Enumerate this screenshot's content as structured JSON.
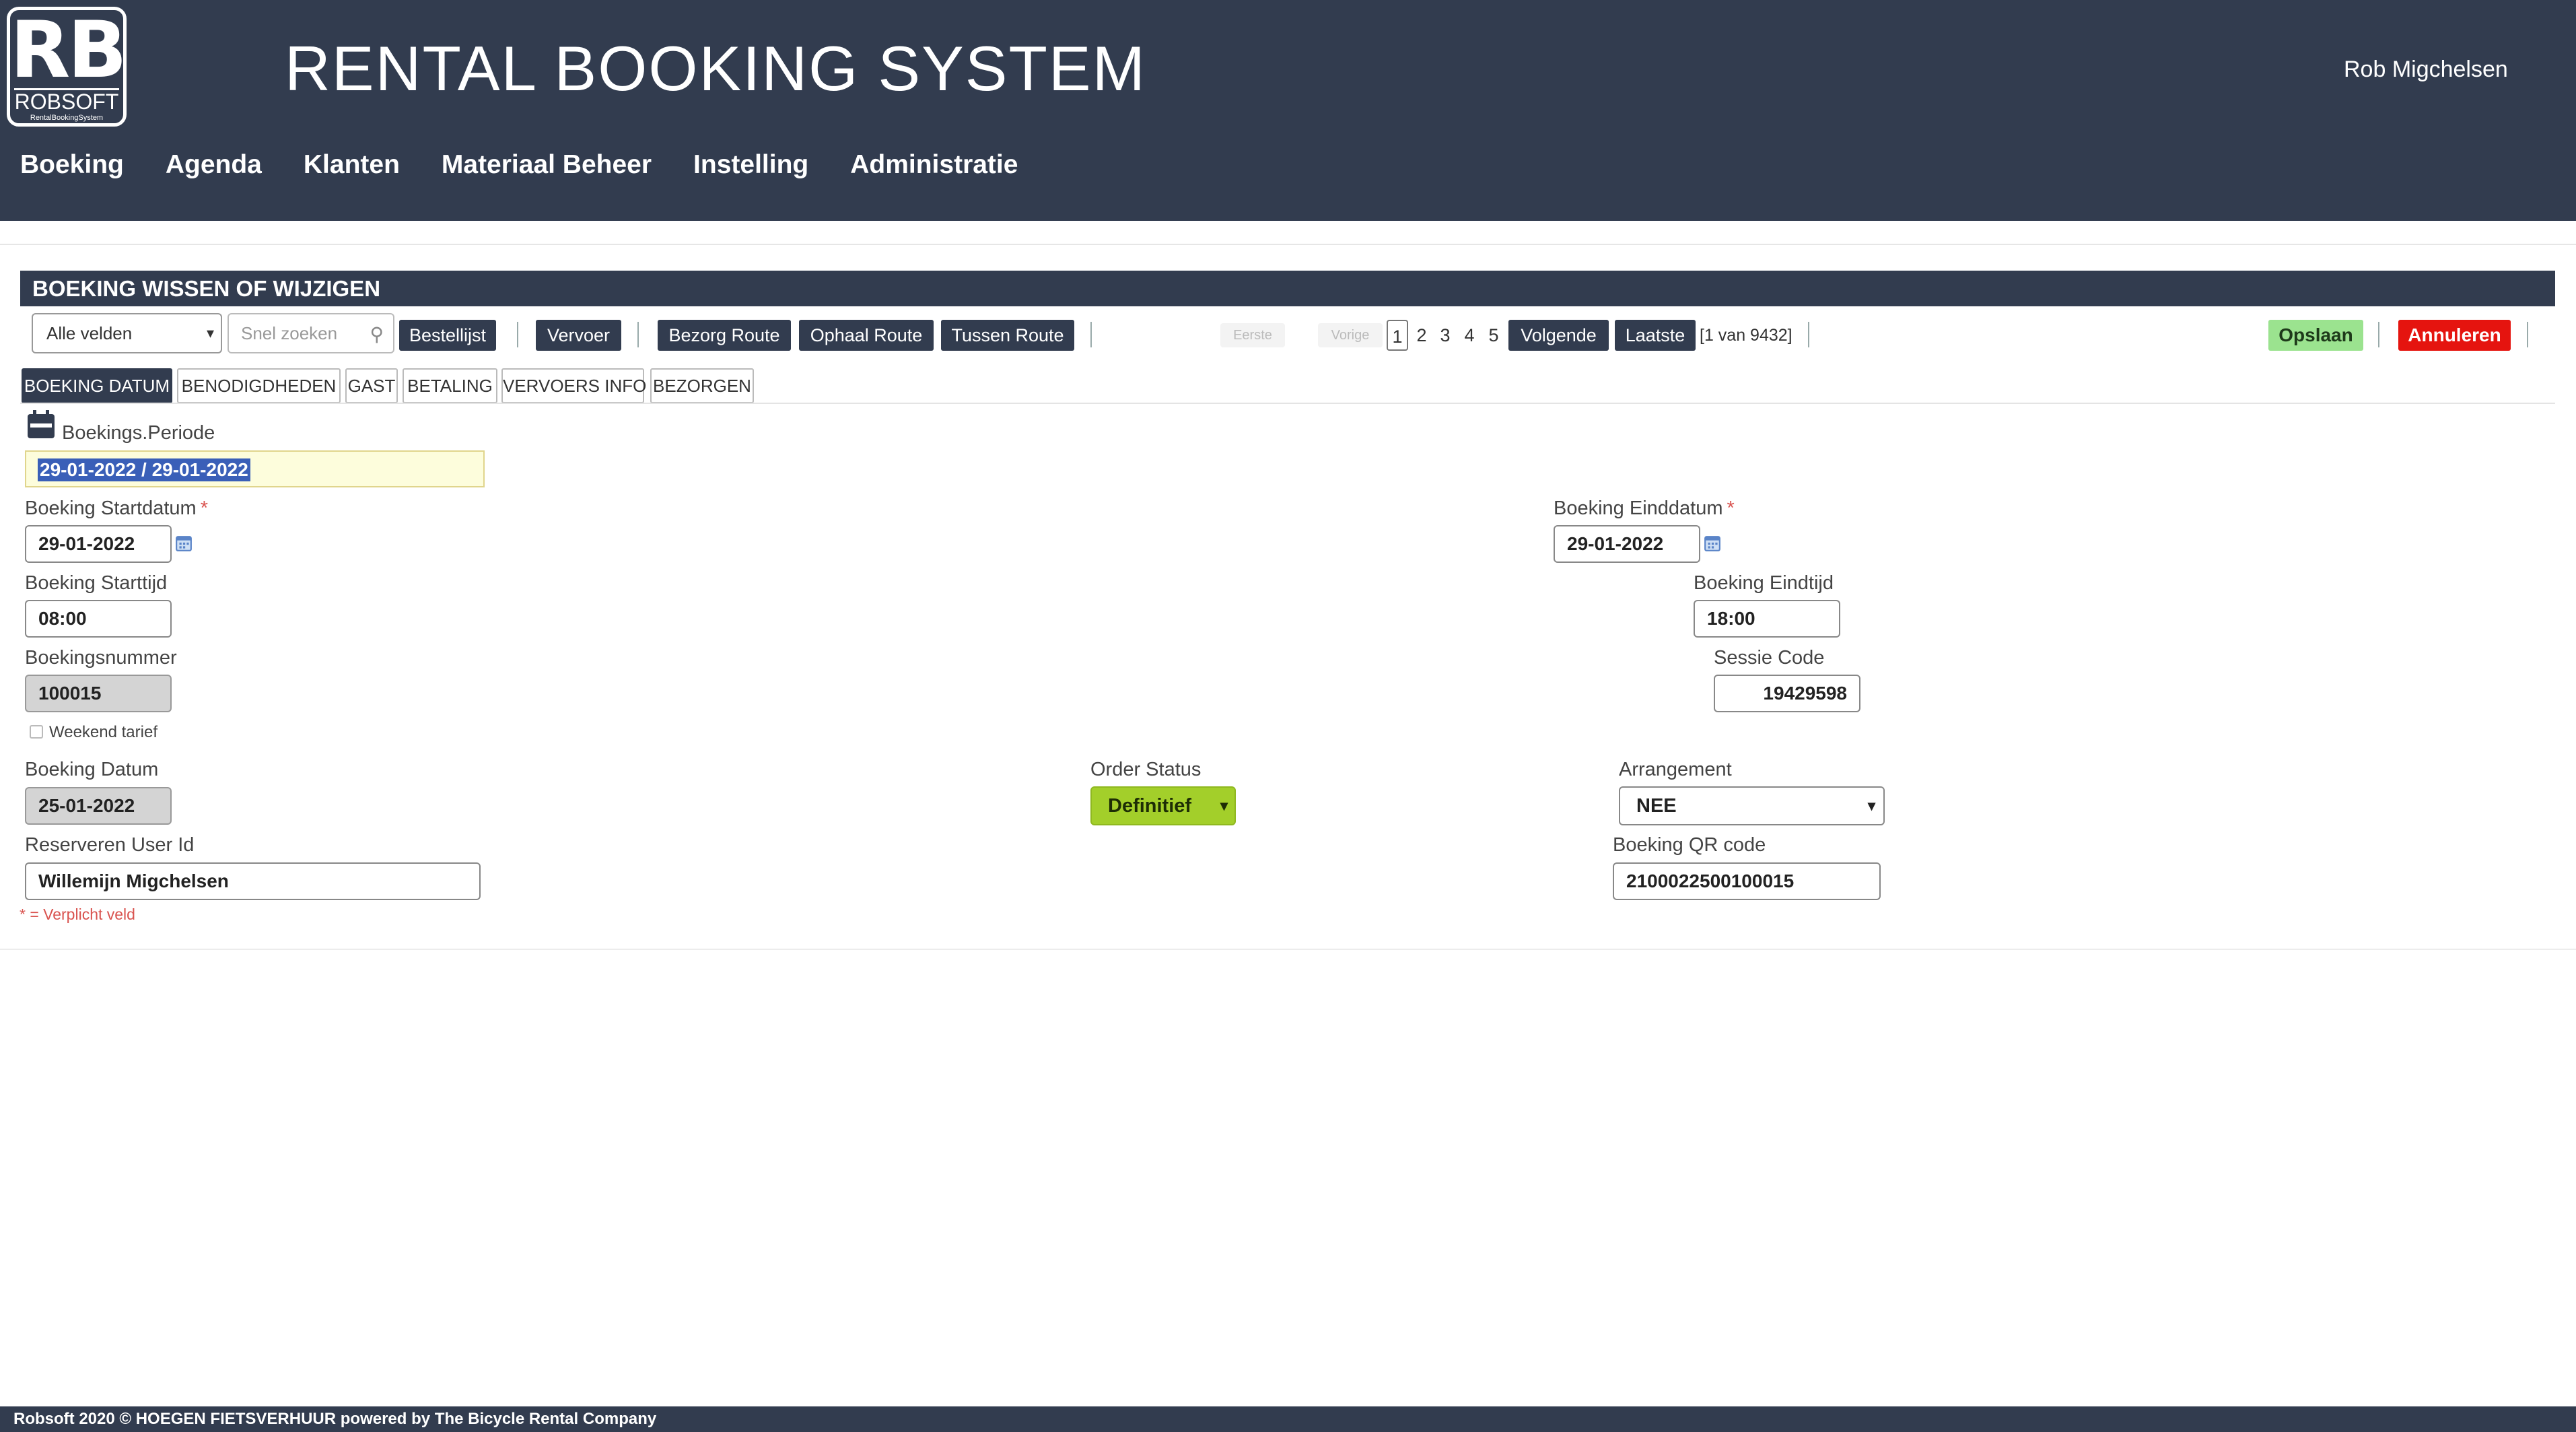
{
  "header": {
    "logo": {
      "letters": "RB",
      "brand": "ROBSOFT",
      "tagline": "RentalBookingSystem"
    },
    "app_title": "RENTAL BOOKING SYSTEM",
    "user_name": "Rob Migchelsen",
    "nav": [
      "Boeking",
      "Agenda",
      "Klanten",
      "Materiaal Beheer",
      "Instelling",
      "Administratie"
    ]
  },
  "section": {
    "title": "BOEKING WISSEN OF WIJZIGEN"
  },
  "toolbar": {
    "field_select": "Alle velden",
    "search_placeholder": "Snel zoeken",
    "bestellijst": "Bestellijst",
    "vervoer": "Vervoer",
    "bezorg_route": "Bezorg Route",
    "ophaal_route": "Ophaal Route",
    "tussen_route": "Tussen Route"
  },
  "pagination": {
    "first": "Eerste",
    "prev": "Vorige",
    "pages": [
      "1",
      "2",
      "3",
      "4",
      "5"
    ],
    "current_page": "1",
    "next": "Volgende",
    "last": "Laatste",
    "info": "[1 van 9432]"
  },
  "actions": {
    "save": "Opslaan",
    "cancel": "Annuleren"
  },
  "tabs": [
    "BOEKING DATUM",
    "BENODIGDHEDEN",
    "GAST",
    "BETALING",
    "VERVOERS INFO",
    "BEZORGEN"
  ],
  "form": {
    "periode_label": "Boekings.Periode",
    "periode_value": "29-01-2022 / 29-01-2022",
    "startdatum_label": "Boeking Startdatum",
    "startdatum_value": "29-01-2022",
    "einddatum_label": "Boeking Einddatum",
    "einddatum_value": "29-01-2022",
    "required_mark": "*",
    "starttijd_label": "Boeking Starttijd",
    "starttijd_value": "08:00",
    "eindtijd_label": "Boeking Eindtijd",
    "eindtijd_value": "18:00",
    "boekingsnummer_label": "Boekingsnummer",
    "boekingsnummer_value": "100015",
    "sessie_label": "Sessie Code",
    "sessie_value": "19429598",
    "weekend_label": "Weekend tarief",
    "weekend_checked": false,
    "boeking_datum_label": "Boeking Datum",
    "boeking_datum_value": "25-01-2022",
    "order_status_label": "Order Status",
    "order_status_value": "Definitief",
    "arrangement_label": "Arrangement",
    "arrangement_value": "NEE",
    "user_id_label": "Reserveren User Id",
    "user_id_value": "Willemijn Migchelsen",
    "qr_label": "Boeking QR code",
    "qr_value": "2100022500100015",
    "required_note": "* = Verplicht veld"
  },
  "footer": {
    "text": "Robsoft 2020 © HOEGEN FIETSVERHUUR powered by The Bicycle Rental Company"
  },
  "colors": {
    "header_bg": "#323c4f",
    "save_bg": "#9be38f",
    "cancel_bg": "#e5140f",
    "status_bg": "#a3cf2a",
    "period_bg": "#fdfddc",
    "selection": "#3a5fb8"
  }
}
